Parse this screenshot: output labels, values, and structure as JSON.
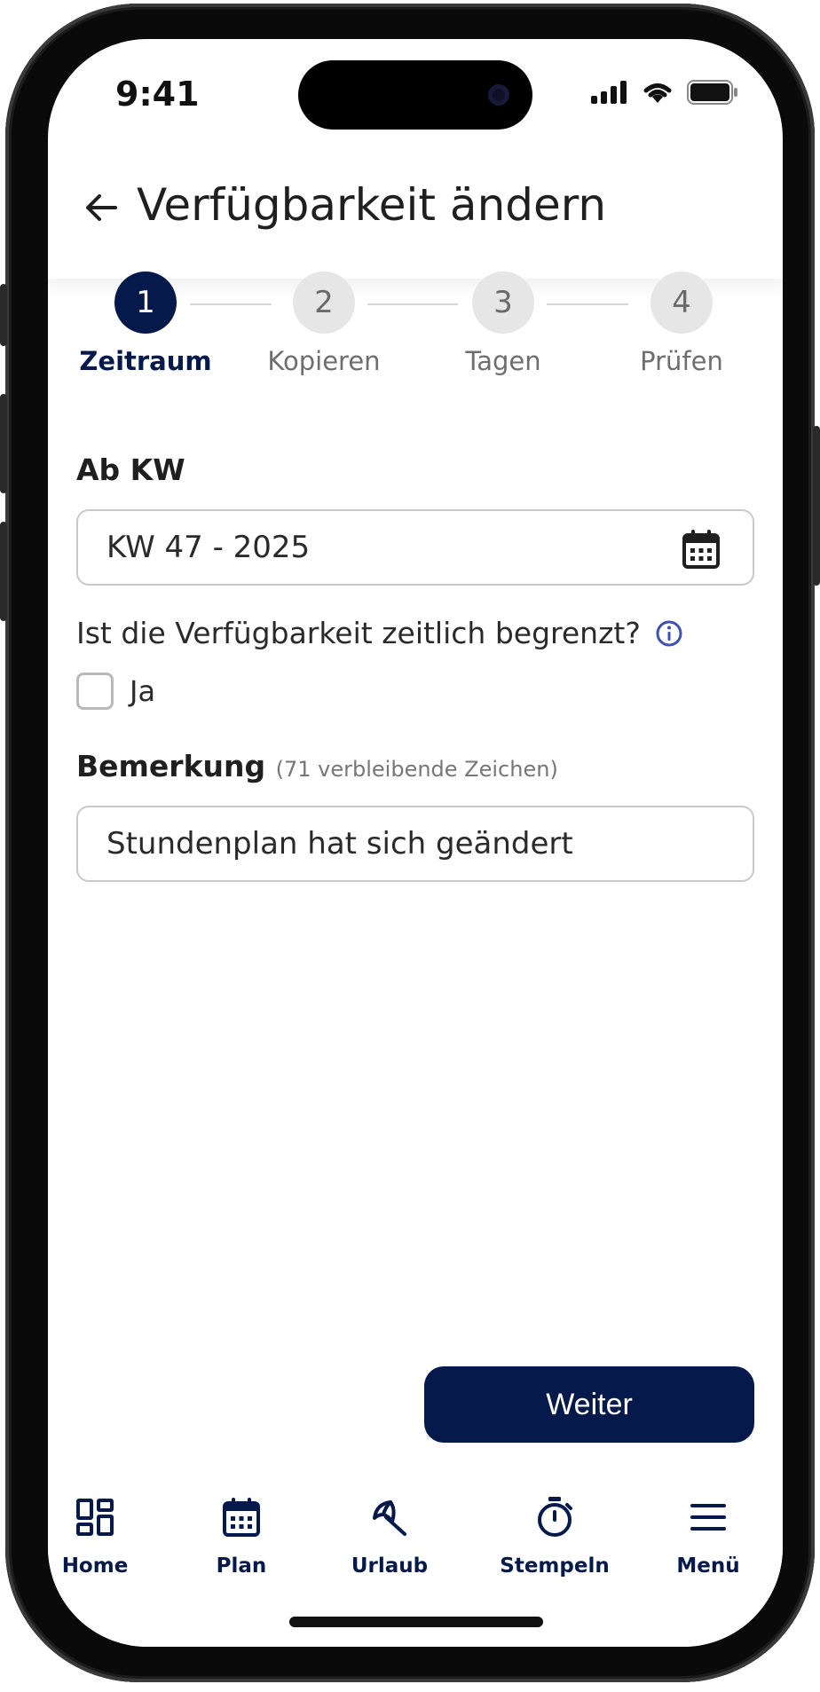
{
  "status_bar": {
    "time": "9:41"
  },
  "header": {
    "title": "Verfügbarkeit ändern"
  },
  "stepper": {
    "steps": [
      {
        "number": "1",
        "label": "Zeitraum"
      },
      {
        "number": "2",
        "label": "Kopieren"
      },
      {
        "number": "3",
        "label": "Tagen"
      },
      {
        "number": "4",
        "label": "Prüfen"
      }
    ],
    "active_step": 1
  },
  "form": {
    "week_label": "Ab KW",
    "week_value": "KW 47 - 2025",
    "limited_question": "Ist die Verfügbarkeit zeitlich begrenzt?",
    "limited_checkbox_label": "Ja",
    "limited_checked": false,
    "remark_label": "Bemerkung",
    "remark_hint": "(71 verbleibende Zeichen)",
    "remark_value": "Stundenplan hat sich geändert"
  },
  "actions": {
    "next_label": "Weiter"
  },
  "bottom_nav": {
    "items": [
      {
        "label": "Home",
        "icon": "dashboard-icon"
      },
      {
        "label": "Plan",
        "icon": "calendar-icon"
      },
      {
        "label": "Urlaub",
        "icon": "beach-umbrella-icon"
      },
      {
        "label": "Stempeln",
        "icon": "stopwatch-icon"
      },
      {
        "label": "Menü",
        "icon": "hamburger-menu-icon"
      }
    ]
  },
  "colors": {
    "primary": "#051a4b",
    "info": "#3f51b5",
    "inactive_step": "#e6e6e6"
  }
}
